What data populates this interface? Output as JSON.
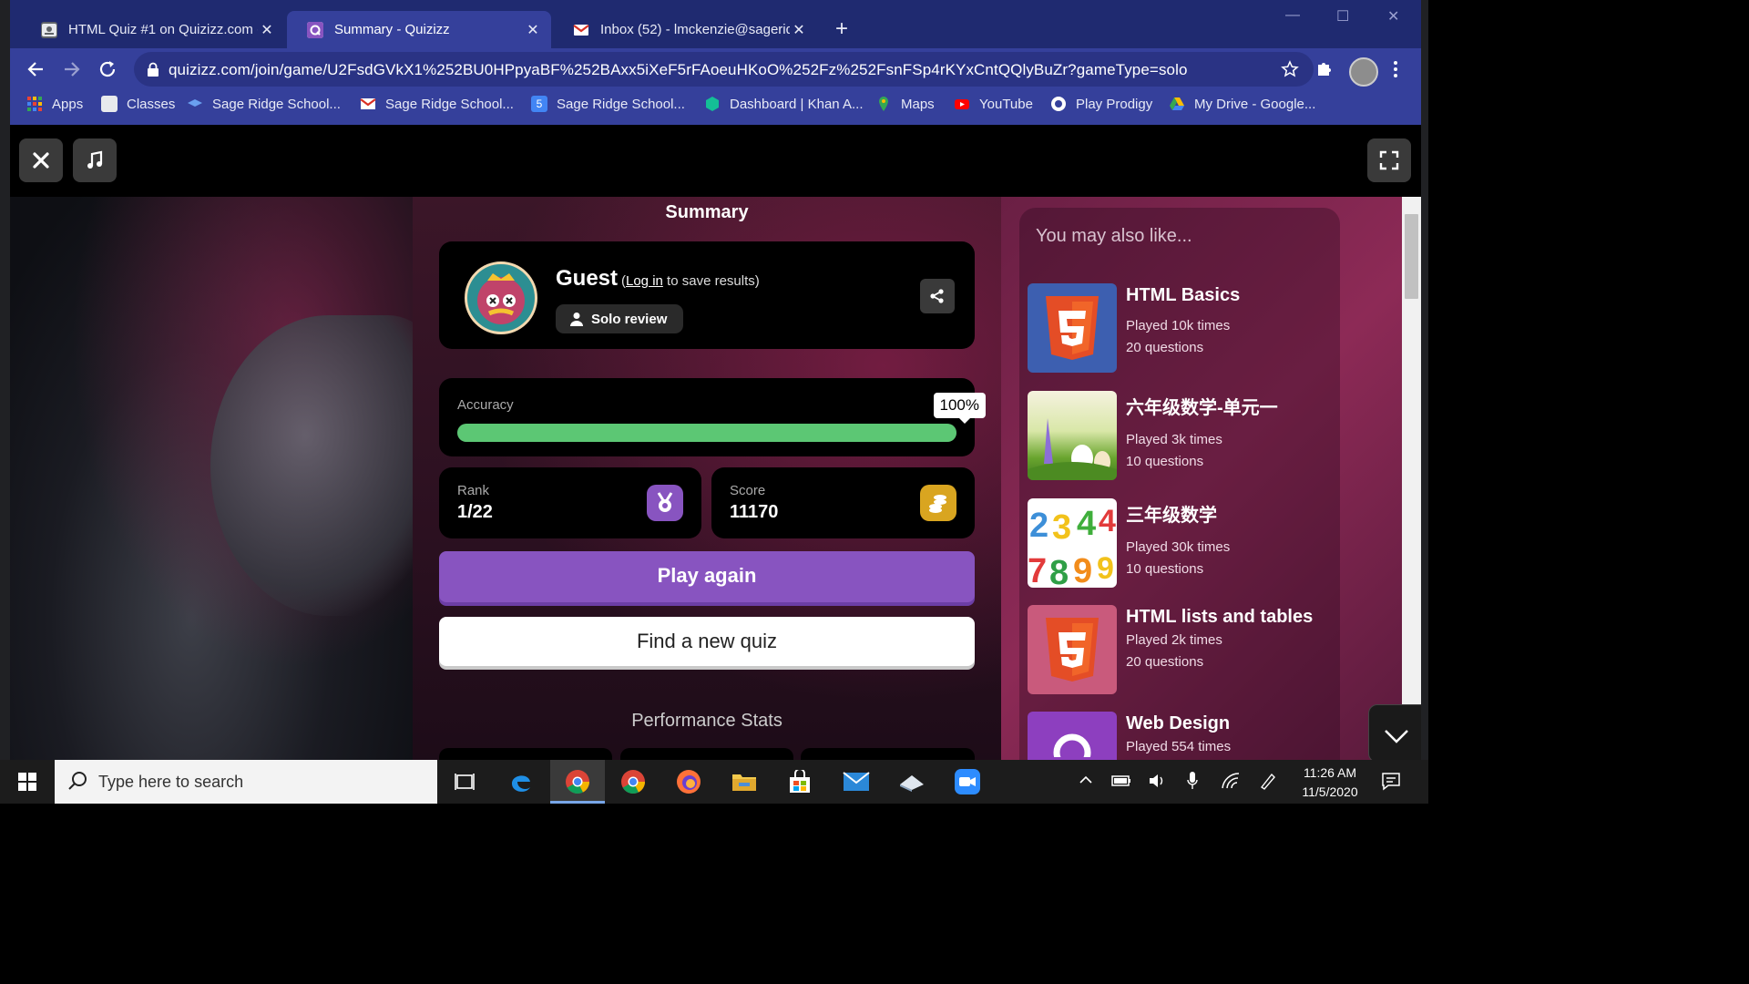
{
  "browser": {
    "tabs": [
      {
        "title": "HTML Quiz #1 on Quizizz.com (p",
        "active": false,
        "icon": "classroom-icon"
      },
      {
        "title": "Summary - Quizizz",
        "active": true,
        "icon": "quizizz-icon"
      },
      {
        "title": "Inbox (52) - lmckenzie@sageridg",
        "active": false,
        "icon": "gmail-icon"
      }
    ],
    "url": "quizizz.com/join/game/U2FsdGVkX1%252BU0HPpyaBF%252BAxx5iXeF5rFAoeuHKoO%252Fz%252FsnFSp4rKYxCntQQlyBuZr?gameType=solo",
    "bookmarks": [
      {
        "label": "Apps",
        "icon": "apps-grid-icon"
      },
      {
        "label": "Classes",
        "icon": "classroom-icon"
      },
      {
        "label": "Sage Ridge School...",
        "icon": "school-hat-icon"
      },
      {
        "label": "Sage Ridge School...",
        "icon": "gmail-icon"
      },
      {
        "label": "Sage Ridge School...",
        "icon": "calendar-icon"
      },
      {
        "label": "Dashboard | Khan A...",
        "icon": "khan-academy-icon"
      },
      {
        "label": "Maps",
        "icon": "maps-pin-icon"
      },
      {
        "label": "YouTube",
        "icon": "youtube-icon"
      },
      {
        "label": "Play Prodigy",
        "icon": "prodigy-icon"
      },
      {
        "label": "My Drive - Google...",
        "icon": "drive-icon"
      }
    ]
  },
  "quiz": {
    "summary_title": "Summary",
    "player": {
      "name": "Guest",
      "login_link": "Log in",
      "login_suffix": "to save results)",
      "login_prefix": "(",
      "mode": "Solo review"
    },
    "accuracy": {
      "label": "Accuracy",
      "value_text": "100%",
      "fraction": 1.0
    },
    "rank": {
      "label": "Rank",
      "value": "1/22"
    },
    "score": {
      "label": "Score",
      "value": "11170"
    },
    "play_again": "Play again",
    "find_quiz": "Find a new quiz",
    "performance_title": "Performance Stats",
    "colors": {
      "accent": "#8854c0",
      "accuracy_bar": "#5cc774",
      "score_icon": "#d9a520"
    }
  },
  "recommendations": {
    "heading": "You may also like...",
    "items": [
      {
        "title": "HTML Basics",
        "played": "Played 10k times",
        "questions": "20 questions",
        "thumb": "html5-icon"
      },
      {
        "title": "六年级数学-单元一",
        "played": "Played 3k times",
        "questions": "10 questions",
        "thumb": "easter-eggs-image"
      },
      {
        "title": "三年级数学",
        "played": "Played 30k times",
        "questions": "10 questions",
        "thumb": "colorful-numbers-image"
      },
      {
        "title": "HTML lists and tables",
        "played": "Played 2k times",
        "questions": "20 questions",
        "thumb": "html5-icon"
      },
      {
        "title": "Web Design",
        "played": "Played 554 times",
        "questions": "",
        "thumb": "web-design-icon"
      }
    ]
  },
  "taskbar": {
    "search_placeholder": "Type here to search",
    "time": "11:26 AM",
    "date": "11/5/2020"
  }
}
